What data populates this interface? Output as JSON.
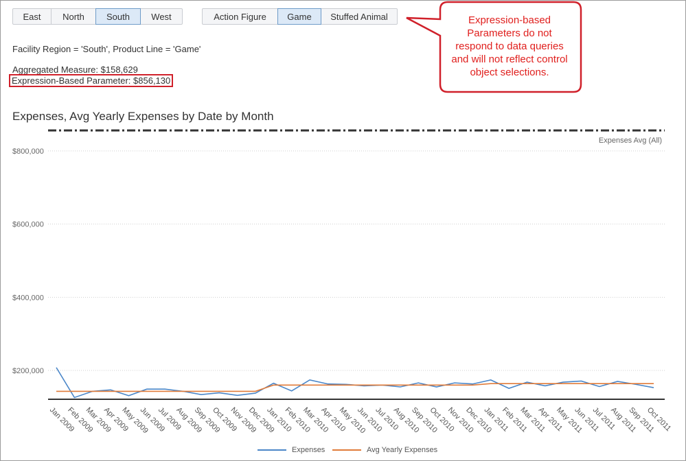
{
  "region_filter": {
    "buttons": [
      "East",
      "North",
      "South",
      "West"
    ],
    "selected": "South"
  },
  "product_filter": {
    "buttons": [
      "Action Figure",
      "Game",
      "Stuffed Animal"
    ],
    "selected": "Game"
  },
  "filter_summary": "Facility Region = 'South', Product Line = 'Game'",
  "aggregated_measure": "Aggregated Measure: $158,629",
  "expression_param": "Expression-Based Parameter: $856,130",
  "callout": {
    "lines": [
      "Expression-based",
      "Parameters do not",
      "respond to data queries",
      "and will not reflect control",
      "object selections."
    ],
    "color": "#e0201e"
  },
  "chart_data": {
    "type": "line",
    "title": "Expenses, Avg Yearly Expenses by Date by Month",
    "y_ticks": [
      "$200,000",
      "$400,000",
      "$600,000",
      "$800,000"
    ],
    "y_tick_values": [
      200000,
      400000,
      600000,
      800000
    ],
    "ylim": [
      110000,
      900000
    ],
    "categories": [
      "Jan 2009",
      "Feb 2009",
      "Mar 2009",
      "Apr 2009",
      "May 2009",
      "Jun 2009",
      "Jul 2009",
      "Aug 2009",
      "Sep 2009",
      "Oct 2009",
      "Nov 2009",
      "Dec 2009",
      "Jan 2010",
      "Feb 2010",
      "Mar 2010",
      "Apr 2010",
      "May 2010",
      "Jun 2010",
      "Jul 2010",
      "Aug 2010",
      "Sep 2010",
      "Oct 2010",
      "Nov 2010",
      "Dec 2010",
      "Jan 2011",
      "Feb 2011",
      "Mar 2011",
      "Apr 2011",
      "May 2011",
      "Jun 2011",
      "Jul 2011",
      "Aug 2011",
      "Sep 2011",
      "Oct 2011"
    ],
    "series": [
      {
        "name": "Expenses",
        "color": "#4a86c8",
        "values": [
          208000,
          126000,
          143000,
          147000,
          131000,
          149000,
          149000,
          143000,
          134000,
          139000,
          132000,
          138000,
          165000,
          144000,
          174000,
          163000,
          162000,
          158000,
          160000,
          155000,
          166000,
          155000,
          166000,
          163000,
          174000,
          151000,
          168000,
          158000,
          168000,
          171000,
          156000,
          170000,
          162000,
          153000
        ]
      },
      {
        "name": "Avg Yearly Expenses",
        "color": "#e07b39",
        "values": [
          143000,
          143000,
          143000,
          143000,
          143000,
          143000,
          143000,
          143000,
          143000,
          143000,
          143000,
          143000,
          160000,
          160000,
          160000,
          160000,
          160000,
          160000,
          160000,
          160000,
          160000,
          160000,
          160000,
          160000,
          164000,
          164000,
          164000,
          164000,
          164000,
          164000,
          164000,
          164000,
          164000,
          164000
        ]
      }
    ],
    "reference_line": {
      "label": "Expenses Avg (All)",
      "value": 856130,
      "style": "dash-dot"
    },
    "legend": [
      "Expenses",
      "Avg Yearly Expenses"
    ],
    "legend_position": "bottom",
    "grid": true
  }
}
